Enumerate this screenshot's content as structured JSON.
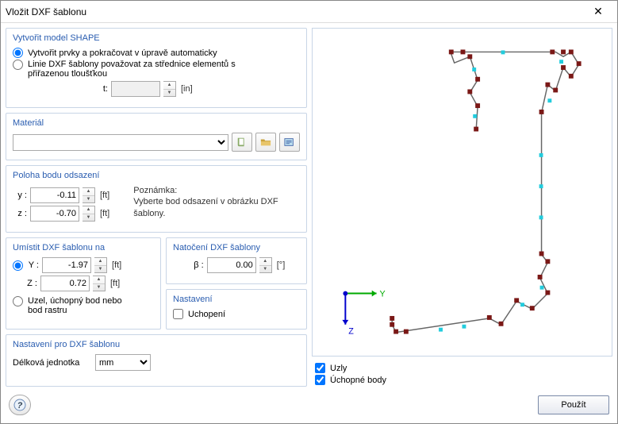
{
  "window": {
    "title": "Vložit DXF šablonu"
  },
  "groups": {
    "shape": {
      "title": "Vytvořit model SHAPE",
      "opt_auto": "Vytvořit prvky a pokračovat v úpravě automaticky",
      "opt_center": "Linie DXF šablony považovat za střednice elementů s přiřazenou tloušťkou",
      "t_label": "t:",
      "t_value": "",
      "t_unit": "[in]"
    },
    "material": {
      "title": "Materiál",
      "value": ""
    },
    "offset": {
      "title": "Poloha bodu odsazení",
      "y_label": "y :",
      "y_value": "-0.11",
      "y_unit": "[ft]",
      "z_label": "z :",
      "z_value": "-0.70",
      "z_unit": "[ft]",
      "note_label": "Poznámka:",
      "note_text": "Vyberte bod odsazení v obrázku DXF šablony."
    },
    "placement": {
      "title": "Umístit DXF šablonu na",
      "yz_opt": "Y :",
      "y_value": "-1.97",
      "y_unit": "[ft]",
      "z_label": "Z :",
      "z_value": "0.72",
      "z_unit": "[ft]",
      "grid_opt": "Uzel, úchopný bod nebo bod rastru"
    },
    "rotation": {
      "title": "Natočení DXF šablony",
      "beta_label": "β :",
      "beta_value": "0.00",
      "beta_unit": "[°]"
    },
    "settings": {
      "title": "Nastavení",
      "snap": "Uchopení"
    },
    "dxfset": {
      "title": "Nastavení pro DXF šablonu",
      "unit_label": "Délková jednotka",
      "unit_value": "mm"
    }
  },
  "preview": {
    "axis_y": "Y",
    "axis_z": "Z",
    "chk_nodes": "Uzly",
    "chk_snap": "Úchopné body"
  },
  "footer": {
    "apply": "Použít"
  },
  "icons": {
    "book": "book-icon",
    "open": "folder-open-icon",
    "edit": "edit-icon",
    "help": "help-icon"
  }
}
